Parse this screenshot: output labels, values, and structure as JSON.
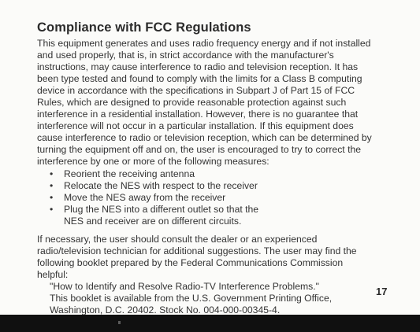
{
  "title": "Compliance with FCC Regulations",
  "paragraph1": [
    "This equipment generates and uses radio frequency energy and if not installed",
    "and used properly, that is, in strict accordance with the manufacturer's",
    "instructions, may cause interference to radio and television reception. It has",
    "been type tested and found to comply with the limits for a Class B computing",
    "device in accordance with the specifications in Subpart J of Part 15 of FCC",
    "Rules, which are designed to provide reasonable protection against such",
    "interference in a residential installation. However, there is no guarantee that",
    "interference will not occur in a particular installation. If this equipment does",
    "cause interference to radio or television reception, which can be determined by",
    "turning the equipment off and on, the user is encouraged to try to correct the",
    "interference by one or more of the following measures:"
  ],
  "bullets": [
    {
      "lines": [
        "Reorient the receiving antenna"
      ]
    },
    {
      "lines": [
        "Relocate the NES with respect to the receiver"
      ]
    },
    {
      "lines": [
        "Move the NES away from the receiver"
      ]
    },
    {
      "lines": [
        "Plug the NES into a different outlet so that the",
        "NES and receiver are on different circuits."
      ]
    }
  ],
  "paragraph2": [
    "If necessary, the user should consult the dealer or an experienced",
    "radio/television technician for additional suggestions. The user may find the",
    "following booklet prepared by the Federal Communications Commission",
    "helpful:"
  ],
  "quote": [
    "\"How to Identify and Resolve Radio-TV Interference Problems.\"",
    "This booklet is available from the U.S. Government Printing Office,",
    "Washington, D.C. 20402. Stock No. 004-000-00345-4."
  ],
  "page_number": "17",
  "colors": {
    "text": "#333333",
    "title": "#2b2b2b",
    "bottom_band": "#101010"
  }
}
